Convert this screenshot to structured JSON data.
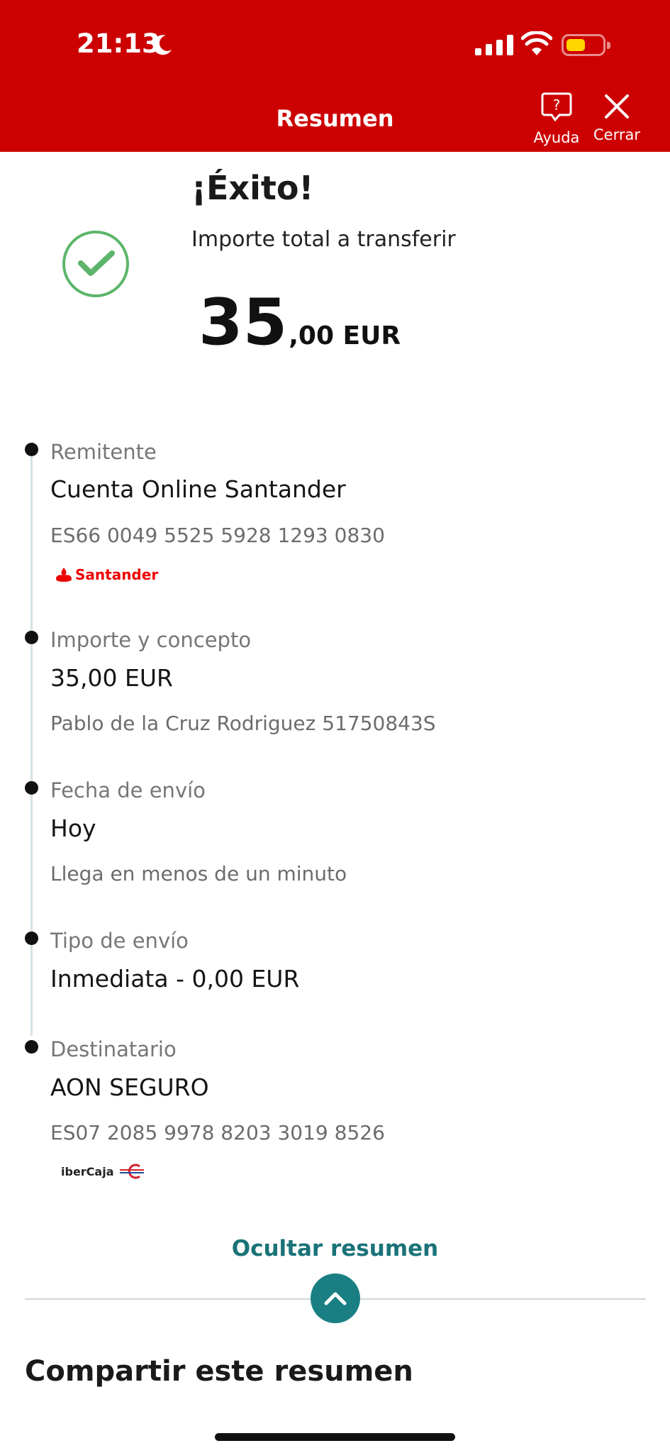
{
  "status_bar": {
    "time": "21:13",
    "colors": {
      "battery": "#ffd600"
    }
  },
  "header": {
    "title": "Resumen",
    "help_label": "Ayuda",
    "close_label": "Cerrar",
    "background": "#cc0000"
  },
  "success": {
    "title": "¡Éxito!",
    "amount_caption": "Importe total a transferir",
    "amount_integer": "35",
    "amount_decimal": ",00 EUR",
    "check_color": "#5db56b"
  },
  "sender": {
    "label": "Remitente",
    "account_name": "Cuenta Online Santander",
    "iban": "ES66 0049 5525 5928 1293 0830",
    "bank_logo_text": "Santander"
  },
  "amount_concept": {
    "label": "Importe y concepto",
    "amount": "35,00 EUR",
    "concept": "Pablo de la Cruz Rodriguez 51750843S"
  },
  "send_date": {
    "label": "Fecha de envío",
    "value": "Hoy",
    "note": "Llega en menos de un minuto"
  },
  "send_type": {
    "label": "Tipo de envío",
    "value": "Inmediata - 0,00 EUR"
  },
  "recipient": {
    "label": "Destinatario",
    "name": "AON SEGURO",
    "iban": "ES07 2085 9978 8203 3019 8526",
    "bank_logo_text": "iberCaja"
  },
  "toggle": {
    "label": "Ocultar resumen",
    "accent": "#1a7f82"
  },
  "share": {
    "title": "Compartir este resumen"
  }
}
